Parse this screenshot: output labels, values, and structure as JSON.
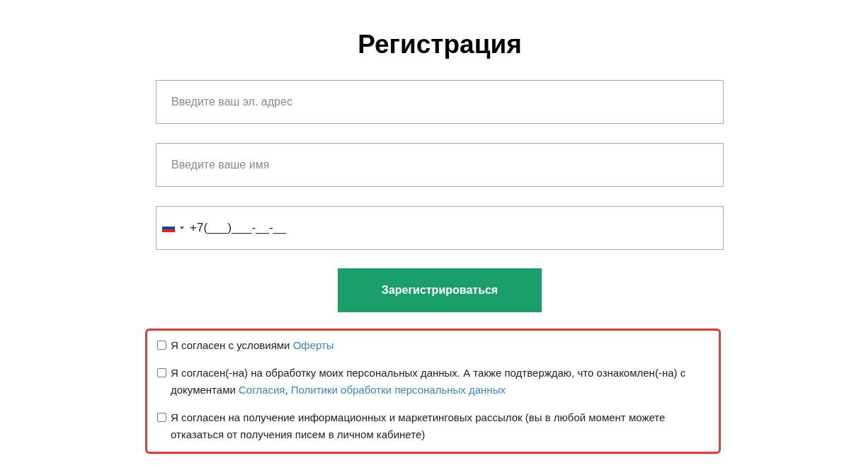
{
  "title": "Регистрация",
  "fields": [
    {
      "kind": "text",
      "placeholder": "Введите ваш эл. адрес"
    },
    {
      "kind": "text",
      "placeholder": "Введите ваше имя"
    },
    {
      "kind": "phone",
      "value": "+7(___)___-__-__"
    }
  ],
  "submit_button": "Зарегистрироваться",
  "consents": {
    "highlighted": true,
    "items": [
      {
        "checked": false,
        "parts": [
          {
            "kind": "text",
            "text": "Я согласен с условиями "
          },
          {
            "kind": "link",
            "text": "Оферты"
          }
        ]
      },
      {
        "checked": false,
        "parts": [
          {
            "kind": "text",
            "text": "Я согласен(-на) на обработку моих персональных данных. А также подтверждаю, что ознакомлен(-на) с документами "
          },
          {
            "kind": "link",
            "text": "Согласия"
          },
          {
            "kind": "text",
            "text": ", "
          },
          {
            "kind": "link",
            "text": "Политики обработки персональных данных"
          }
        ]
      },
      {
        "checked": false,
        "parts": [
          {
            "kind": "text",
            "text": "Я согласен на получение информационных и маркетинговых рассылок (вы в любой момент можете отказаться от получения писем в личном кабинете)"
          }
        ]
      }
    ]
  }
}
